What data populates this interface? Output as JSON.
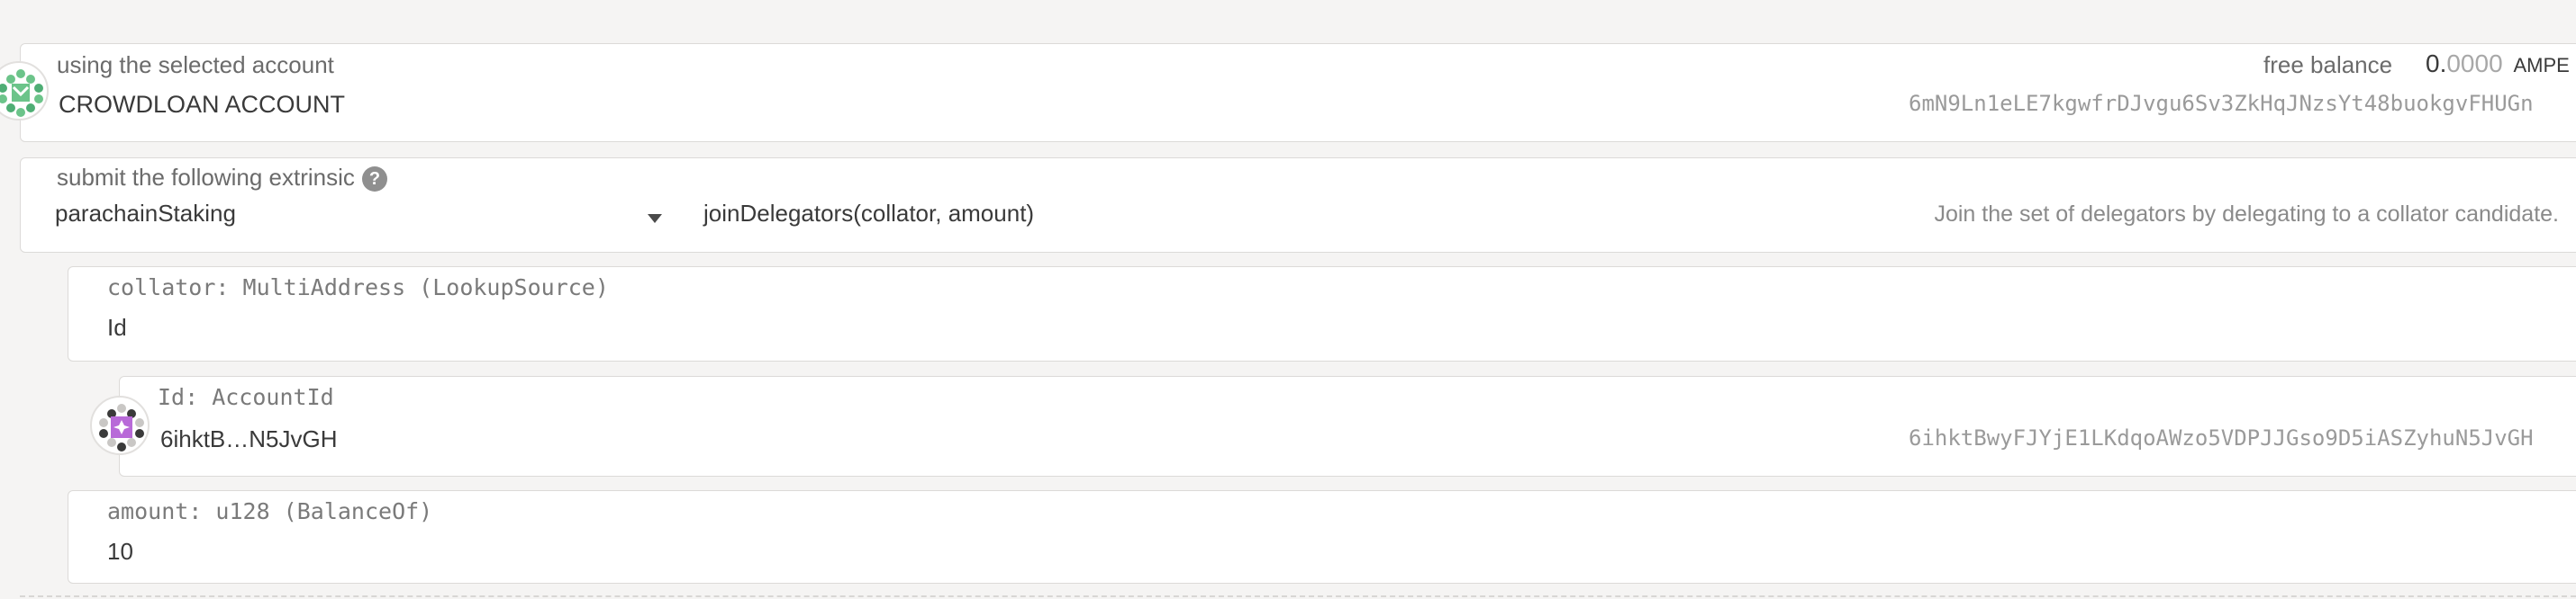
{
  "account": {
    "label": "using the selected account",
    "name": "CROWDLOAN ACCOUNT",
    "balance_label": "free balance",
    "balance_int": "0.",
    "balance_frac": "0000",
    "balance_unit": "AMPE",
    "address": "6mN9Ln1eLE7kgwfrDJvgu6Sv3ZkHqJNzsYt48buokgvFHUGn"
  },
  "extrinsic": {
    "label": "submit the following extrinsic",
    "help": "?",
    "section": "parachainStaking",
    "method": "joinDelegators(collator, amount)",
    "description": "Join the set of delegators by delegating to a collator candidate."
  },
  "collator": {
    "label": "collator: MultiAddress (LookupSource)",
    "value": "Id"
  },
  "id_field": {
    "label": "Id: AccountId",
    "short": "6ihktB…N5JvGH",
    "address": "6ihktBwyFJYjE1LKdqoAWzo5VDPJJGso9D5iASZyhuN5JvGH"
  },
  "amount": {
    "label": "amount: u128 (BalanceOf)",
    "value": "10"
  },
  "colors": {
    "identicon_green": "#6cc48a",
    "identicon_purple": "#b86ad8"
  }
}
